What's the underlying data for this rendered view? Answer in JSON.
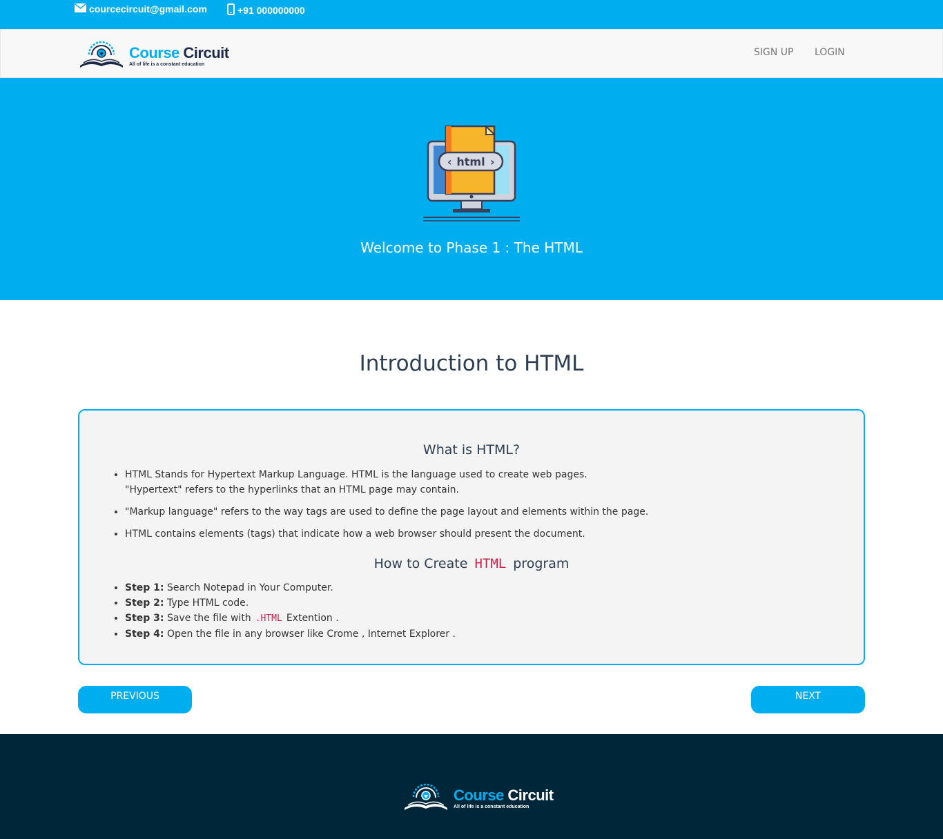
{
  "topbar": {
    "email": "courcecircuit@gmail.com",
    "phone": "+91 000000000"
  },
  "brand": {
    "first": "Course",
    "second": "Circuit",
    "tagline": "All of life is a constant education",
    "colors": {
      "accent": "#00aeef",
      "footer": "#00263a"
    }
  },
  "nav": {
    "signup": "SIGN UP",
    "login": "LOGIN"
  },
  "hero": {
    "image_label": "html",
    "title": "Welcome to Phase 1 : The HTML"
  },
  "main": {
    "title": "Introduction to HTML",
    "section1": {
      "heading": "What is HTML?",
      "items": [
        {
          "line1": "HTML Stands for Hypertext Markup Language. HTML is the language used to create web pages.",
          "line2": "\"Hypertext\" refers to the hyperlinks that an HTML page may contain."
        },
        {
          "line1": "\"Markup language\" refers to the way tags are used to define the page layout and elements within the page."
        },
        {
          "line1": "HTML contains elements (tags) that indicate how a web browser should present the document."
        }
      ]
    },
    "section2": {
      "heading_pre": "How to Create",
      "heading_code": "HTML",
      "heading_post": "program",
      "steps": [
        {
          "label": "Step 1:",
          "text": "Search Notepad in Your Computer."
        },
        {
          "label": "Step 2:",
          "text": "Type HTML code."
        },
        {
          "label": "Step 3:",
          "text_pre": "Save the file with",
          "code": ".HTML",
          "text_post": "Extention ."
        },
        {
          "label": "Step 4:",
          "text": "Open the file in any browser like Crome , Internet Explorer ."
        }
      ]
    },
    "buttons": {
      "previous": "PREVIOUS",
      "next": "NEXT"
    }
  }
}
